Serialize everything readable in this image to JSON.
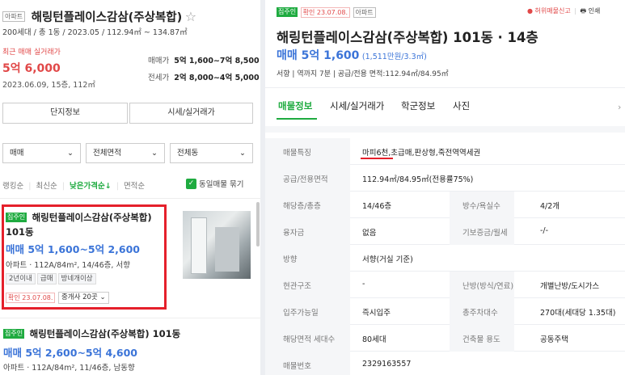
{
  "left": {
    "header": {
      "type_badge": "아파트",
      "complex_name": "해링턴플레이스감삼(주상복합)",
      "star": "☆",
      "summary": "200세대 / 총 1동 / 2023.05 / 112.94㎡ ~ 134.87㎡"
    },
    "recent": {
      "label": "최근 매매 실거래가",
      "price": "5억 6,000",
      "date": "2023.06.09, 15층, 112㎡",
      "sale_label": "매매가",
      "sale_value": "5억 1,600~7억 8,500",
      "jeonse_label": "전세가",
      "jeonse_value": "2억 8,000~4억 5,000"
    },
    "buttons": {
      "info": "단지정보",
      "price": "시세/실거래가"
    },
    "filters": {
      "deal": "매매",
      "area": "전체면적",
      "dong": "전체동"
    },
    "sort": {
      "items": [
        "랭킹순",
        "최신순",
        "낮은가격순↓",
        "면적순"
      ],
      "group_label": "동일매물 묶기"
    },
    "listings": [
      {
        "badge": "집주인",
        "title": "해링턴플레이스감삼(주상복합)",
        "title2": "101동",
        "price": "매매 5억 1,600~5억 2,600",
        "spec": "아파트 · 112A/84m², 14/46층, 서향",
        "tags": [
          "2년이내",
          "급매",
          "방네개이상"
        ],
        "confirm": "확인 23.07.08.",
        "agent": "중개사 20곳"
      },
      {
        "badge": "집주인",
        "title": "해링턴플레이스감삼(주상복합) 101동",
        "price": "매매 5억 2,600~5억 4,600",
        "spec": "아파트 · 112A/84m², 11/46층, 남동향"
      }
    ]
  },
  "right": {
    "badge_owner": "집주인",
    "badge_confirm": "확인 23.07.08.",
    "badge_type": "아파트",
    "report": "허위매물신고",
    "print": "인쇄",
    "title": "해링턴플레이스감삼(주상복합) 101동 · 14층",
    "price_main": "매매 5억 1,600",
    "price_unit": "(1,511만원/3.3㎡)",
    "meta": "서향 | 역까지 7분 | 공급/전용 면적:112.94㎡/84.95㎡",
    "tabs": [
      "매물정보",
      "시세/실거래가",
      "학군정보",
      "사진"
    ],
    "rows": {
      "feature_label": "매물특징",
      "feature_value": "마피6천,초급매,판상형,죽전역역세권",
      "area_label": "공급/전용면적",
      "area_value": "112.94㎡/84.95㎡(전용률75%)",
      "floor_label": "해당층/총층",
      "floor_value": "14/46층",
      "rooms_label": "방수/욕실수",
      "rooms_value": "4/2개",
      "loan_label": "융자금",
      "loan_value": "없음",
      "deposit_label": "기보증금/월세",
      "deposit_value": "-/-",
      "dir_label": "방향",
      "dir_value": "서향(거실 기준)",
      "entry_struct_label": "현관구조",
      "entry_struct_value": "-",
      "heat_label": "난방(방식/연료)",
      "heat_value": "개별난방/도시가스",
      "move_label": "입주가능일",
      "move_value": "즉시입주",
      "park_label": "총주차대수",
      "park_value": "270대(세대당 1.35대)",
      "households_label": "해당면적 세대수",
      "households_value": "80세대",
      "use_label": "건축물 용도",
      "use_value": "공동주택",
      "num_label": "매물번호",
      "num_value": "2329163557"
    }
  }
}
